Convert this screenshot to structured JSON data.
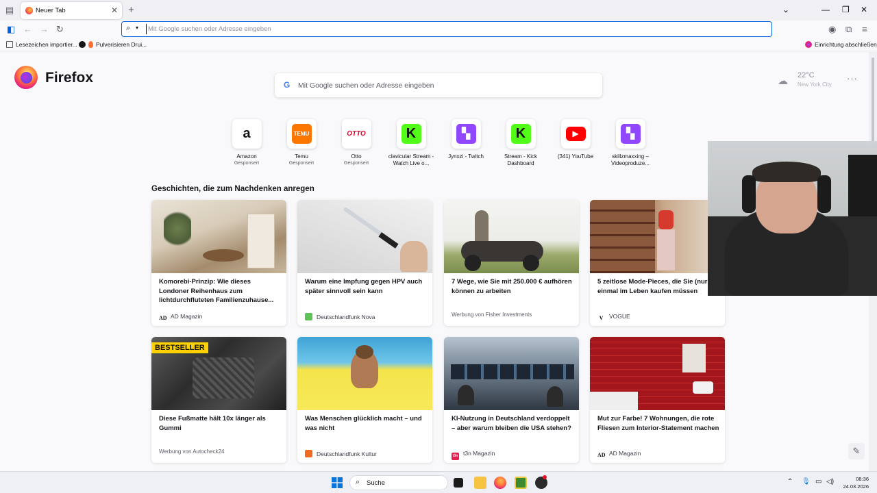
{
  "browser": {
    "tab": {
      "title": "Neuer Tab"
    },
    "urlbar": {
      "placeholder": "Mit Google suchen oder Adresse eingeben"
    },
    "bookmarks": [
      {
        "label": "Lesezeichen importier..."
      },
      {
        "label": "Pulverisieren Drui..."
      }
    ],
    "setup_label": "Einrichtung abschließen"
  },
  "newtab": {
    "brand": "Firefox",
    "search_placeholder": "Mit Google suchen oder Adresse eingeben",
    "weather": {
      "temp": "22°C",
      "city": "New York City"
    },
    "top_sites": [
      {
        "name": "Amazon",
        "sponsor": "Gesponsert",
        "glyph": "a",
        "bg": "#ffffff",
        "fg": "#111111"
      },
      {
        "name": "Temu",
        "sponsor": "Gesponsert",
        "glyph": "TEMU",
        "bg": "#fb7701",
        "fg": "#ffffff"
      },
      {
        "name": "Otto",
        "sponsor": "Gesponsert",
        "glyph": "otto",
        "bg": "#ffffff",
        "fg": "#e4002b"
      },
      {
        "name": "clavicular Stream - Watch Live o...",
        "sponsor": "",
        "glyph": "K",
        "bg": "#53fc18",
        "fg": "#111111"
      },
      {
        "name": "Jynxzi - Twitch",
        "sponsor": "",
        "glyph": "t",
        "bg": "#9146ff",
        "fg": "#ffffff"
      },
      {
        "name": "Stream - Kick Dashboard",
        "sponsor": "",
        "glyph": "K",
        "bg": "#53fc18",
        "fg": "#111111"
      },
      {
        "name": "(341) YouTube",
        "sponsor": "",
        "glyph": "▶",
        "bg": "#ff0000",
        "fg": "#ffffff"
      },
      {
        "name": "skillzmaxxing – Videoproduze...",
        "sponsor": "",
        "glyph": "t",
        "bg": "#9146ff",
        "fg": "#ffffff"
      }
    ],
    "stories_title": "Geschichten, die zum Nachdenken anregen",
    "stories": [
      {
        "title": "Komorebi-Prinzip: Wie dieses Londoner Reihenhaus zum lichtdurchfluteten Familienzuhause...",
        "source": "AD Magazin",
        "icon": "AD",
        "icon_bg": "#ffffff",
        "icon_fg": "#111111",
        "sponsored": false
      },
      {
        "title": "Warum eine Impfung gegen HPV auch später sinnvoll sein kann",
        "source": "Deutschlandfunk Nova",
        "icon": "",
        "icon_bg": "#5ec259",
        "icon_fg": "#ffffff",
        "sponsored": false
      },
      {
        "title": "7 Wege, wie Sie mit 250.000 € aufhören können zu arbeiten",
        "source": "Werbung von Fisher Investments",
        "icon": "",
        "icon_bg": "#ffffff",
        "icon_fg": "#111111",
        "sponsored": true
      },
      {
        "title": "5 zeitlose Mode-Pieces, die Sie (nur einmal im Leben kaufen müssen",
        "source": "VOGUE",
        "icon": "V",
        "icon_bg": "#ffffff",
        "icon_fg": "#111111",
        "sponsored": false
      },
      {
        "title": "Diese Fußmatte hält 10x länger als Gummi",
        "source": "Werbung von Autocheck24",
        "icon": "",
        "icon_bg": "#ffffff",
        "icon_fg": "#111111",
        "sponsored": true,
        "badge": "BESTSELLER"
      },
      {
        "title": "Was Menschen glücklich macht – und was nicht",
        "source": "Deutschlandfunk Kultur",
        "icon": "",
        "icon_bg": "#f26a21",
        "icon_fg": "#ffffff",
        "sponsored": false
      },
      {
        "title": "KI-Nutzung in Deutschland verdoppelt – aber warum bleiben die USA stehen?",
        "source": "t3n Magazin",
        "icon": "t3n",
        "icon_bg": "#e2204f",
        "icon_fg": "#ffffff",
        "sponsored": false
      },
      {
        "title": "Mut zur Farbe! 7 Wohnungen, die rote Fliesen zum Interior-Statement machen",
        "source": "AD Magazin",
        "icon": "AD",
        "icon_bg": "#ffffff",
        "icon_fg": "#111111",
        "sponsored": false
      }
    ]
  },
  "taskbar": {
    "search_label": "Suche",
    "time": "08:36",
    "date": "24.03.2026"
  },
  "colors": {
    "accent": "#0061e0",
    "firefox_orange": "#ff7139"
  }
}
